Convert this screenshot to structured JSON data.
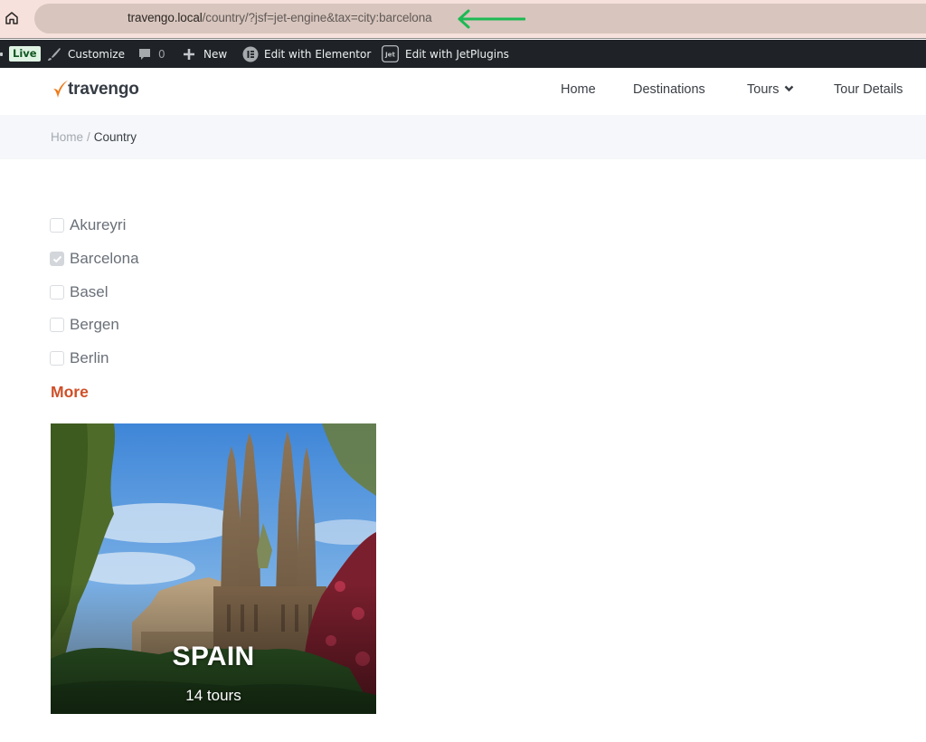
{
  "browser": {
    "url_host": "travengo.local",
    "url_path": "/country/?jsf=jet-engine&tax=city:barcelona",
    "arrow_color": "#1db954"
  },
  "adminbar": {
    "live_label": "Live",
    "customize_label": "Customize",
    "comments_count": "0",
    "new_label": "New",
    "elementor_label": "Edit with Elementor",
    "jetplugins_label": "Edit with JetPlugins"
  },
  "header": {
    "logo_text": "travengo",
    "nav": [
      {
        "label": "Home"
      },
      {
        "label": "Destinations"
      },
      {
        "label": "Tours",
        "has_dropdown": true
      },
      {
        "label": "Tour Details"
      }
    ]
  },
  "breadcrumb": {
    "home": "Home",
    "separator": "/",
    "current": "Country"
  },
  "filter": {
    "items": [
      {
        "label": "Akureyri",
        "checked": false
      },
      {
        "label": "Barcelona",
        "checked": true
      },
      {
        "label": "Basel",
        "checked": false
      },
      {
        "label": "Bergen",
        "checked": false
      },
      {
        "label": "Berlin",
        "checked": false
      }
    ],
    "more_label": "More"
  },
  "card": {
    "title": "SPAIN",
    "subtitle": "14 tours",
    "image_subject": "Sagrada Familia, Barcelona"
  },
  "colors": {
    "accent": "#cf4f28",
    "admin_bar": "#1f2327",
    "breadcrumb_bg": "#f5f7fa",
    "logo_orange": "#f07a1a"
  }
}
